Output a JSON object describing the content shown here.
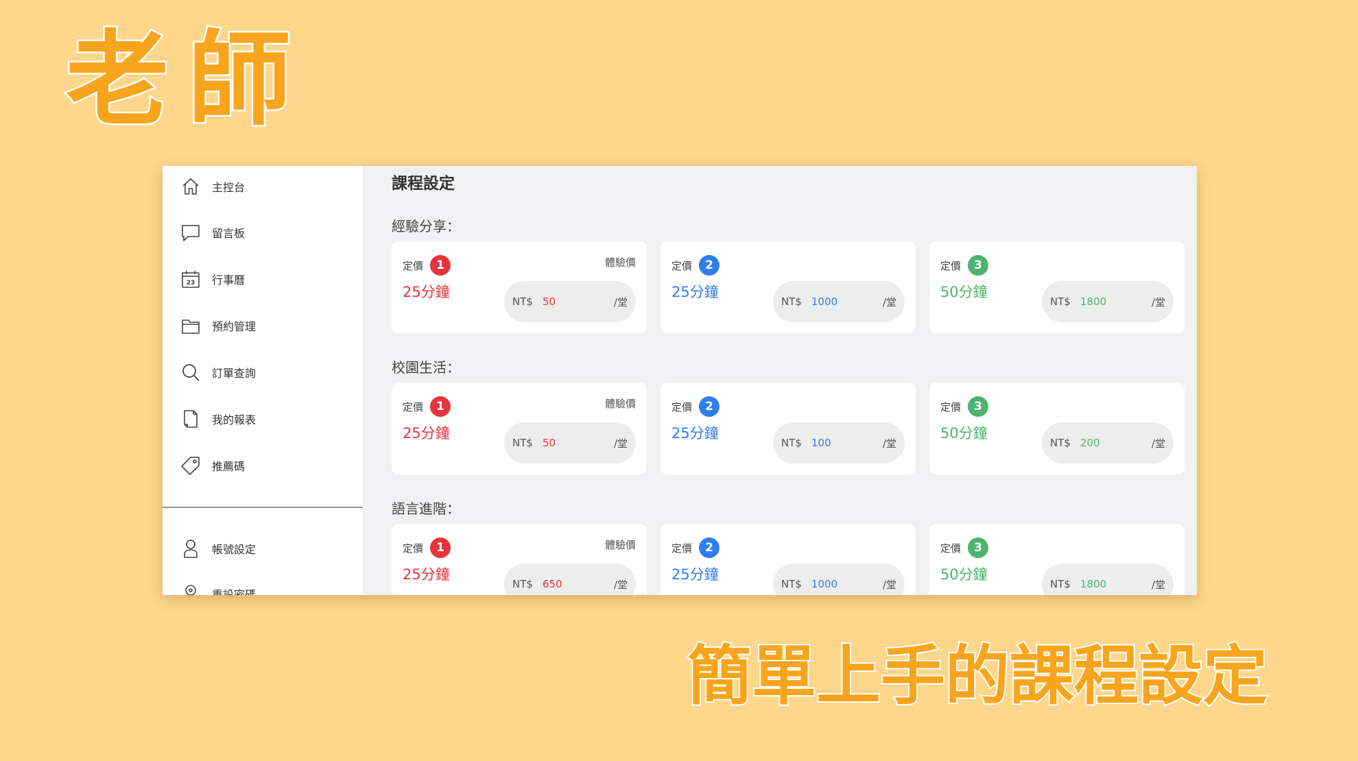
{
  "hero": {
    "title": "老師",
    "subtitle": "簡單上手的課程設定"
  },
  "sidebar": {
    "items": [
      {
        "label": "主控台",
        "icon": "home-icon"
      },
      {
        "label": "留言板",
        "icon": "chat-bubble-icon"
      },
      {
        "label": "行事曆",
        "icon": "calendar-icon",
        "icon_text": "23"
      },
      {
        "label": "預約管理",
        "icon": "folder-icon"
      },
      {
        "label": "訂單查詢",
        "icon": "search-icon"
      },
      {
        "label": "我的報表",
        "icon": "document-icon"
      },
      {
        "label": "推薦碼",
        "icon": "tag-icon"
      }
    ],
    "bottom_items": [
      {
        "label": "帳號設定",
        "icon": "user-icon"
      },
      {
        "label": "重設密碼",
        "icon": "key-icon"
      }
    ]
  },
  "main": {
    "title": "課程設定",
    "tag_label": "定價",
    "trial_label": "體驗價",
    "currency": "NT$",
    "unit": "/堂",
    "badge_colors": [
      "#e5343b",
      "#2f7ef0",
      "#4cb46f"
    ],
    "sections": [
      {
        "label": "經驗分享：",
        "cards": [
          {
            "badge": "1",
            "duration": "25分鐘",
            "price": "50",
            "trial": true
          },
          {
            "badge": "2",
            "duration": "25分鐘",
            "price": "1000",
            "trial": false
          },
          {
            "badge": "3",
            "duration": "50分鐘",
            "price": "1800",
            "trial": false
          }
        ]
      },
      {
        "label": "校園生活：",
        "cards": [
          {
            "badge": "1",
            "duration": "25分鐘",
            "price": "50",
            "trial": true
          },
          {
            "badge": "2",
            "duration": "25分鐘",
            "price": "100",
            "trial": false
          },
          {
            "badge": "3",
            "duration": "50分鐘",
            "price": "200",
            "trial": false
          }
        ]
      },
      {
        "label": "語言進階：",
        "cards": [
          {
            "badge": "1",
            "duration": "25分鐘",
            "price": "650",
            "trial": true
          },
          {
            "badge": "2",
            "duration": "25分鐘",
            "price": "1000",
            "trial": false
          },
          {
            "badge": "3",
            "duration": "50分鐘",
            "price": "1800",
            "trial": false
          }
        ]
      }
    ]
  }
}
